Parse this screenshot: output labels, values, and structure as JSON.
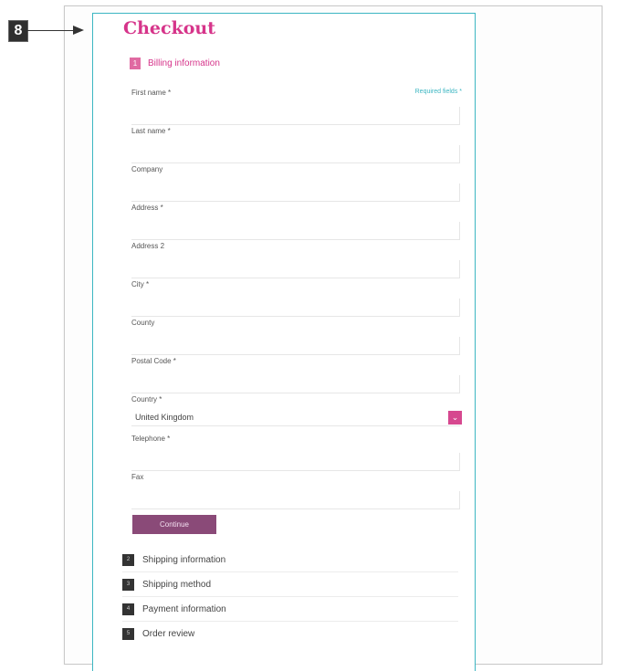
{
  "callout": "8",
  "page": {
    "title": "Checkout",
    "required_note": "Required fields *",
    "billing": {
      "step": "1",
      "label": "Billing information"
    }
  },
  "fields": [
    {
      "name": "first-name",
      "label": "First name *"
    },
    {
      "name": "last-name",
      "label": "Last name *"
    },
    {
      "name": "company",
      "label": "Company"
    },
    {
      "name": "address",
      "label": "Address *"
    },
    {
      "name": "address-2",
      "label": "Address 2"
    },
    {
      "name": "city",
      "label": "City *"
    },
    {
      "name": "county",
      "label": "County"
    },
    {
      "name": "postal-code",
      "label": "Postal Code *"
    }
  ],
  "country": {
    "label": "Country *",
    "value": "United Kingdom",
    "icon": "chevron-down-icon"
  },
  "telephone": {
    "label": "Telephone *"
  },
  "fax": {
    "label": "Fax"
  },
  "continue_label": "Continue",
  "steps": [
    {
      "num": "2",
      "label": "Shipping information"
    },
    {
      "num": "3",
      "label": "Shipping method"
    },
    {
      "num": "4",
      "label": "Payment information"
    },
    {
      "num": "5",
      "label": "Order review"
    }
  ],
  "colors": {
    "accent": "#d6348a",
    "frame": "#3cb6c2",
    "button": "#8a4a78"
  }
}
